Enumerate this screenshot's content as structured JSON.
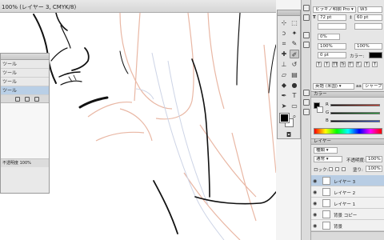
{
  "document": {
    "tab_title": "100% (レイヤー 3, CMYK/8)"
  },
  "floating_panel": {
    "rows": [
      {
        "label": "ツール"
      },
      {
        "label": "ツール"
      },
      {
        "label": "ツール"
      },
      {
        "label": "ツール",
        "selected": true
      }
    ],
    "footer_text": "不透明度 100%"
  },
  "character_panel": {
    "font_family": "ヒラギノ明朝 Pro",
    "font_style": "W3",
    "font_size": "72 pt",
    "leading": "60 pt",
    "kerning": "0%",
    "vertical_scale": "100%",
    "horizontal_scale": "100%",
    "baseline": "0 pt",
    "color_label": "カラー:",
    "style_buttons": [
      "T",
      "T",
      "TT",
      "Tr",
      "T'",
      "T,",
      "T",
      "T"
    ],
    "language": "英語 (米国)",
    "antialias_prefix": "aa",
    "antialias": "シャープ"
  },
  "color_panel": {
    "title": "カラー",
    "channels": [
      "R",
      "G",
      "B"
    ],
    "colors": {
      "red": "#d23a2b",
      "green": "#26a33a",
      "blue": "#2f54d8"
    }
  },
  "layers_panel": {
    "title": "レイヤー",
    "kind_label": "種類",
    "blend_mode": "通常",
    "opacity_label": "不透明度:",
    "opacity": "100%",
    "lock_label": "ロック:",
    "fill_label": "塗り:",
    "fill": "100%",
    "layers": [
      {
        "name": "レイヤー 3",
        "selected": true
      },
      {
        "name": "レイヤー 2",
        "selected": false
      },
      {
        "name": "レイヤー 1",
        "selected": false
      },
      {
        "name": "背景 コピー",
        "selected": false
      },
      {
        "name": "背景",
        "selected": false
      }
    ]
  }
}
